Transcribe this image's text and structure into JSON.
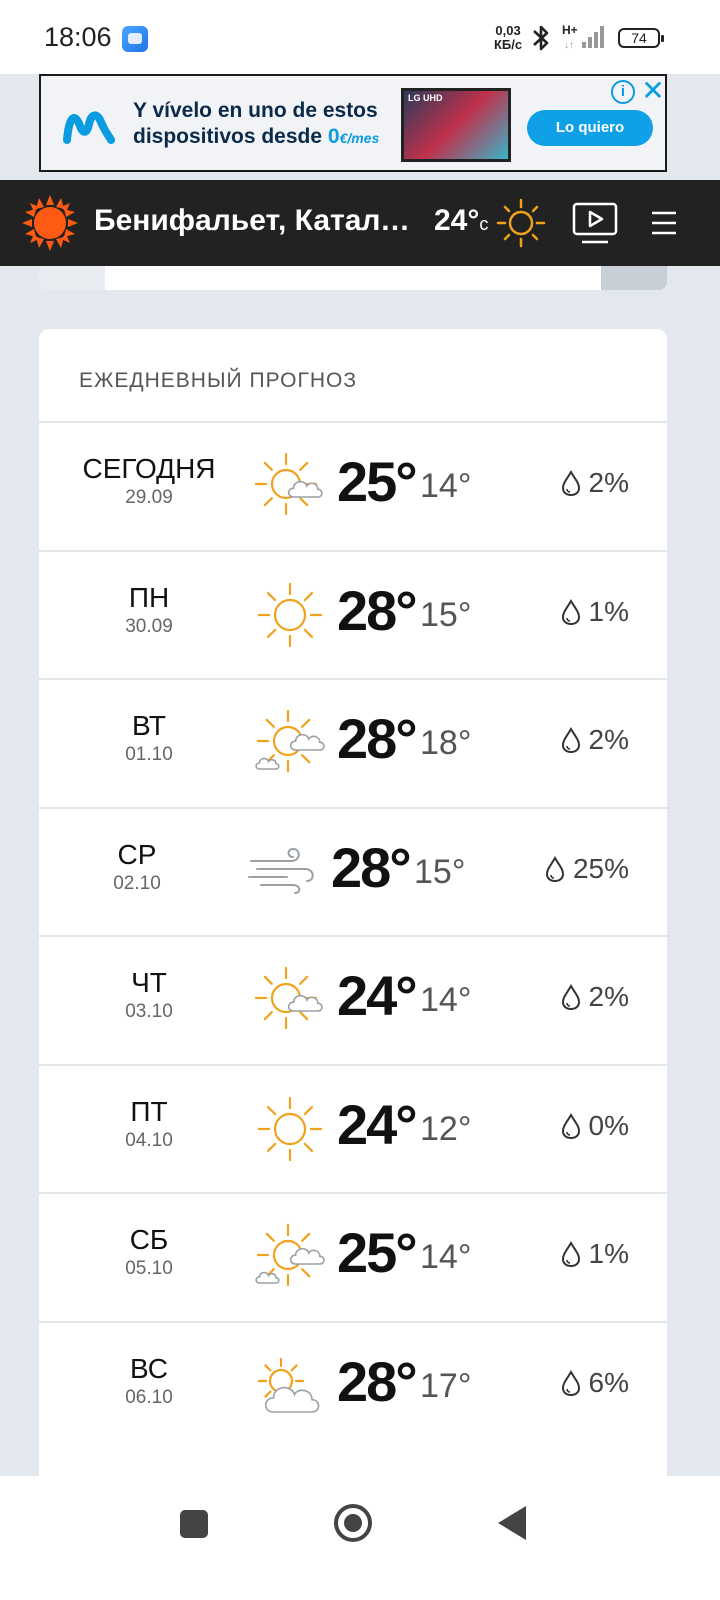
{
  "status_bar": {
    "time": "18:06",
    "net_speed_value": "0,03",
    "net_speed_unit": "КБ/с",
    "network_type": "H+",
    "battery": "74"
  },
  "ad": {
    "line1": "Y vívelo en uno de estos",
    "line2_prefix": "dispositivos desde ",
    "line2_price": "0",
    "line2_unit": "€/mes",
    "tv_brand": "LG UHD",
    "cta": "Lo quiero",
    "info": "i",
    "close": "✕"
  },
  "header": {
    "location": "Бенифальет, Катало...",
    "temp": "24°",
    "temp_unit": "c",
    "accent_color": "#ff6a13"
  },
  "forecast": {
    "title": "ЕЖЕДНЕВНЫЙ ПРОГНОЗ",
    "days": [
      {
        "day": "СЕГОДНЯ",
        "date": "29.09",
        "icon": "sun-cloud-icon",
        "max": "25°",
        "min": "14°",
        "precip": "2%"
      },
      {
        "day": "ПН",
        "date": "30.09",
        "icon": "sun-icon",
        "max": "28°",
        "min": "15°",
        "precip": "1%"
      },
      {
        "day": "ВТ",
        "date": "01.10",
        "icon": "sun-clouds-icon",
        "max": "28°",
        "min": "18°",
        "precip": "2%"
      },
      {
        "day": "СР",
        "date": "02.10",
        "icon": "wind-icon",
        "max": "28°",
        "min": "15°",
        "precip": "25%"
      },
      {
        "day": "ЧТ",
        "date": "03.10",
        "icon": "sun-cloud-icon",
        "max": "24°",
        "min": "14°",
        "precip": "2%"
      },
      {
        "day": "ПТ",
        "date": "04.10",
        "icon": "sun-icon",
        "max": "24°",
        "min": "12°",
        "precip": "0%"
      },
      {
        "day": "СБ",
        "date": "05.10",
        "icon": "sun-clouds-icon",
        "max": "25°",
        "min": "14°",
        "precip": "1%"
      },
      {
        "day": "ВС",
        "date": "06.10",
        "icon": "partly-cloudy-icon",
        "max": "28°",
        "min": "17°",
        "precip": "6%"
      }
    ]
  }
}
